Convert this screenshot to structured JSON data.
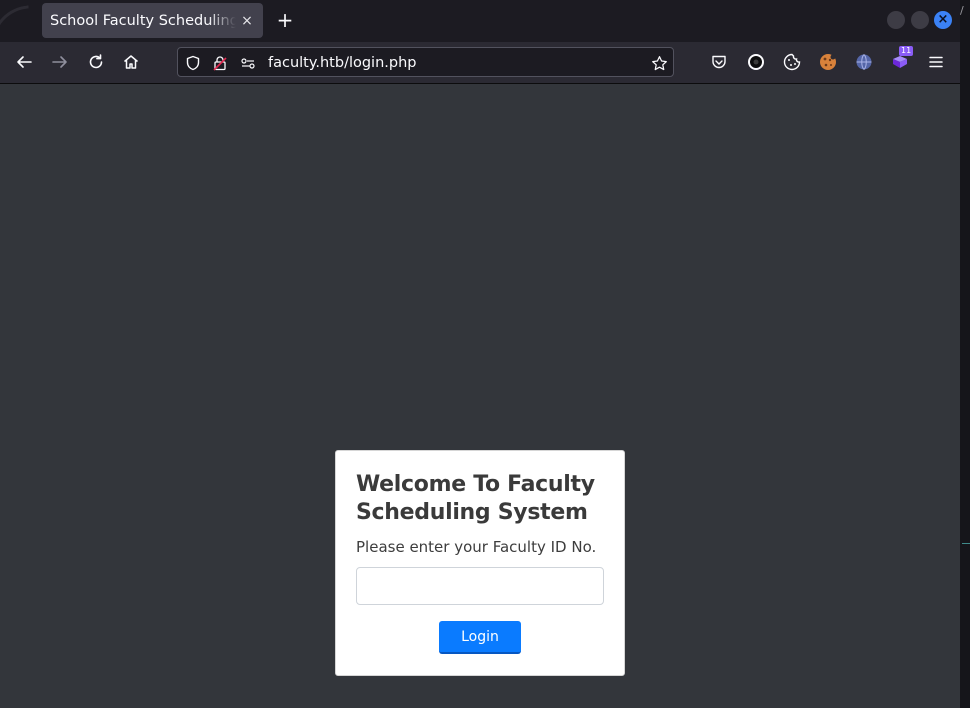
{
  "browser": {
    "tab": {
      "title": "School Faculty Scheduling System",
      "close_icon": "×"
    },
    "new_tab_icon": "+",
    "window_close_icon": "×",
    "url": "faculty.htb/login.php",
    "extensions": {
      "badge_count": "11"
    }
  },
  "login": {
    "heading": "Welcome To Faculty Scheduling System",
    "prompt": "Please enter your Faculty ID No.",
    "id_value": "",
    "id_placeholder": "",
    "button_label": "Login"
  },
  "colors": {
    "page_background": "#33363b",
    "button": "#0a7bff",
    "toolbar": "#2b2a33",
    "tabbar": "#1c1b22"
  },
  "icons": [
    "back-icon",
    "forward-icon",
    "reload-icon",
    "home-icon",
    "shield-icon",
    "lock-warning-icon",
    "permissions-icon",
    "star-icon",
    "pocket-icon",
    "extension-dark-circle-icon",
    "cookie-icon",
    "cookie-color-icon",
    "globe-icon",
    "extension-purple-icon",
    "menu-icon"
  ]
}
